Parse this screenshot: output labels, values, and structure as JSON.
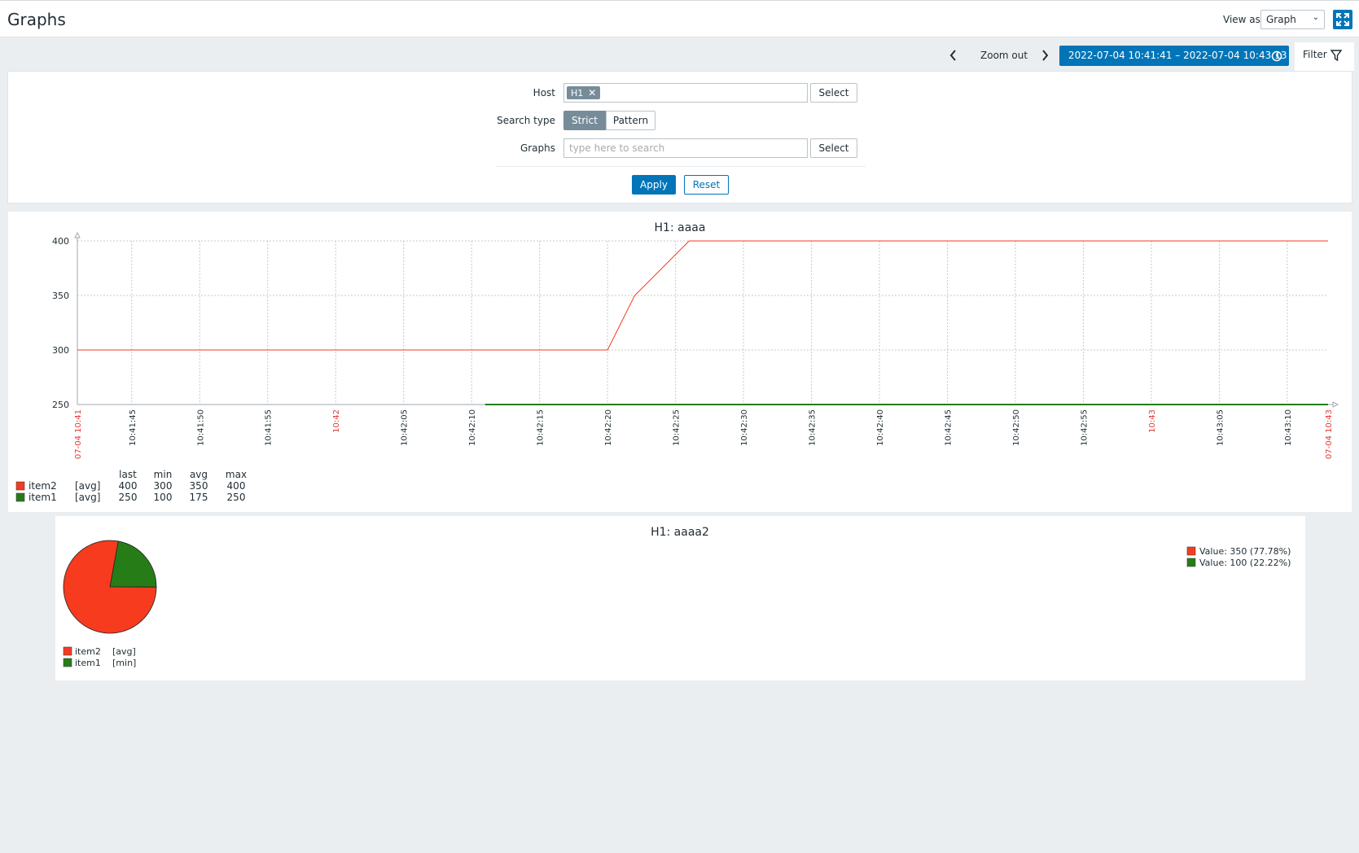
{
  "header": {
    "title": "Graphs",
    "view_as_label": "View as",
    "view_as_value": "Graph"
  },
  "timebar": {
    "zoom_out": "Zoom out",
    "range": "2022-07-04 10:41:41 – 2022-07-04 10:43:13",
    "filter_label": "Filter"
  },
  "filter": {
    "host_label": "Host",
    "host_tag": "H1",
    "select_label": "Select",
    "search_type_label": "Search type",
    "strict_label": "Strict",
    "pattern_label": "Pattern",
    "graphs_label": "Graphs",
    "graphs_placeholder": "type here to search",
    "apply_label": "Apply",
    "reset_label": "Reset"
  },
  "colors": {
    "accent": "#0275b8",
    "series_red": "#f63b1e",
    "series_green": "#267d17"
  },
  "chart_data": [
    {
      "type": "line",
      "title": "H1: aaaa",
      "yticks": [
        250,
        300,
        350,
        400
      ],
      "ylim": [
        250,
        400
      ],
      "x_range": [
        "10:41:41",
        "10:43:13"
      ],
      "xtick_labels": [
        {
          "label": "07-04 10:41",
          "t": 0,
          "highlight": true
        },
        {
          "label": "10:41:45",
          "t": 4
        },
        {
          "label": "10:41:50",
          "t": 9
        },
        {
          "label": "10:41:55",
          "t": 14
        },
        {
          "label": "10:42",
          "t": 19,
          "highlight": true
        },
        {
          "label": "10:42:05",
          "t": 24
        },
        {
          "label": "10:42:10",
          "t": 29
        },
        {
          "label": "10:42:15",
          "t": 34
        },
        {
          "label": "10:42:20",
          "t": 39
        },
        {
          "label": "10:42:25",
          "t": 44
        },
        {
          "label": "10:42:30",
          "t": 49
        },
        {
          "label": "10:42:35",
          "t": 54
        },
        {
          "label": "10:42:40",
          "t": 59
        },
        {
          "label": "10:42:45",
          "t": 64
        },
        {
          "label": "10:42:50",
          "t": 69
        },
        {
          "label": "10:42:55",
          "t": 74
        },
        {
          "label": "10:43",
          "t": 79,
          "highlight": true
        },
        {
          "label": "10:43:05",
          "t": 84
        },
        {
          "label": "10:43:10",
          "t": 89
        },
        {
          "label": "07-04 10:43",
          "t": 92,
          "highlight": true
        }
      ],
      "series": [
        {
          "name": "item2",
          "func": "[avg]",
          "color": "#f63b1e",
          "points": [
            [
              0,
              300
            ],
            [
              39,
              300
            ],
            [
              41,
              350
            ],
            [
              45,
              400
            ],
            [
              92,
              400
            ]
          ],
          "last": "400",
          "min": "300",
          "avg": "350",
          "max": "400"
        },
        {
          "name": "item1",
          "func": "[avg]",
          "color": "#267d17",
          "points": [
            [
              30,
              250
            ],
            [
              92,
              250
            ]
          ],
          "last": "250",
          "min": "100",
          "avg": "175",
          "max": "250"
        }
      ],
      "legend_headers": [
        "last",
        "min",
        "avg",
        "max"
      ]
    },
    {
      "type": "pie",
      "title": "H1: aaaa2",
      "slices": [
        {
          "name": "item2",
          "func": "[avg]",
          "value": 350,
          "percent": 77.78,
          "color": "#f63b1e",
          "label": "Value: 350 (77.78%)"
        },
        {
          "name": "item1",
          "func": "[min]",
          "value": 100,
          "percent": 22.22,
          "color": "#267d17",
          "label": "Value: 100 (22.22%)"
        }
      ]
    }
  ]
}
